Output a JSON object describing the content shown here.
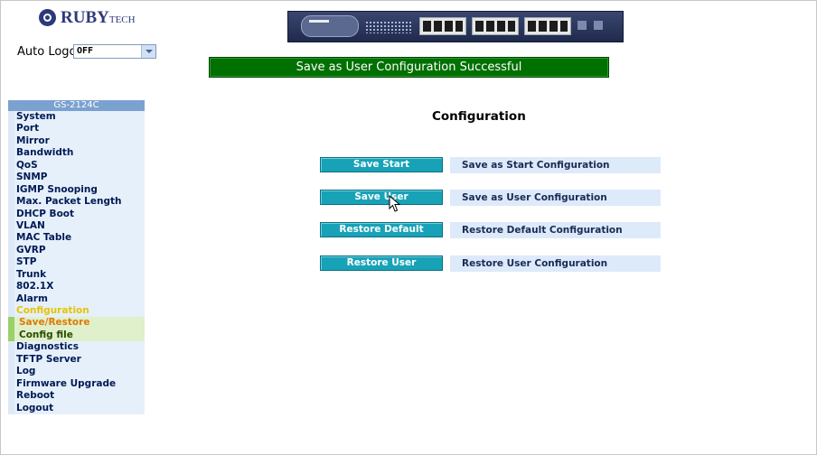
{
  "brand": {
    "name": "RUBY",
    "suffix": "TECH"
  },
  "auto_logout": {
    "label": "Auto Logout",
    "value": "OFF"
  },
  "status_banner": "Save as User Configuration Successful",
  "sidebar": {
    "title": "GS-2124C",
    "items": [
      {
        "label": "System"
      },
      {
        "label": "Port"
      },
      {
        "label": "Mirror"
      },
      {
        "label": "Bandwidth"
      },
      {
        "label": "QoS"
      },
      {
        "label": "SNMP"
      },
      {
        "label": "IGMP Snooping"
      },
      {
        "label": "Max. Packet Length"
      },
      {
        "label": "DHCP Boot"
      },
      {
        "label": "VLAN"
      },
      {
        "label": "MAC Table"
      },
      {
        "label": "GVRP"
      },
      {
        "label": "STP"
      },
      {
        "label": "Trunk"
      },
      {
        "label": "802.1X"
      },
      {
        "label": "Alarm"
      },
      {
        "label": "Configuration"
      },
      {
        "label": "Save/Restore"
      },
      {
        "label": "Config file"
      },
      {
        "label": "Diagnostics"
      },
      {
        "label": "TFTP Server"
      },
      {
        "label": "Log"
      },
      {
        "label": "Firmware Upgrade"
      },
      {
        "label": "Reboot"
      },
      {
        "label": "Logout"
      }
    ]
  },
  "main": {
    "title": "Configuration",
    "actions": [
      {
        "button": "Save Start",
        "description": "Save as Start Configuration"
      },
      {
        "button": "Save User",
        "description": "Save as User Configuration"
      },
      {
        "button": "Restore Default",
        "description": "Restore Default Configuration"
      },
      {
        "button": "Restore User",
        "description": "Restore User Configuration"
      }
    ]
  },
  "colors": {
    "banner_bg": "#007000",
    "button_bg": "#17a2b8",
    "sidebar_title_bg": "#7ba1d0",
    "active_item": "#e6c400",
    "current_subitem": "#e07a00"
  }
}
